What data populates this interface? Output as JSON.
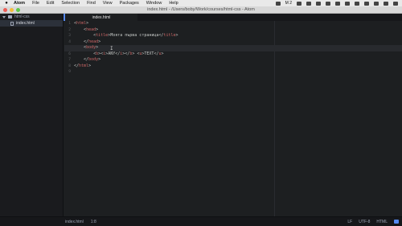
{
  "menubar": {
    "apple_icon": "apple-icon",
    "items": [
      "Atom",
      "File",
      "Edit",
      "Selection",
      "Find",
      "View",
      "Packages",
      "Window",
      "Help"
    ],
    "status_text": "M 2"
  },
  "window": {
    "title": "index.html - /Users/boby/Work/courses/html-css - Atom"
  },
  "tabs": [
    {
      "label": "index.html",
      "active": true
    }
  ],
  "tree": {
    "project": "html-css",
    "files": [
      "index.html"
    ]
  },
  "editor": {
    "line_numbers": [
      "1",
      "2",
      "3",
      "4",
      "5",
      "6",
      "7",
      "8",
      "9"
    ],
    "active_line": 5
  },
  "code": {
    "l1": {
      "open": "<",
      "tag": "html",
      "close": ">"
    },
    "l2": {
      "open": "<",
      "tag": "head",
      "close": ">"
    },
    "l3": {
      "open": "<",
      "tag": "title",
      "close": ">",
      "text": "Моята първа страница",
      "eopen": "</",
      "etag": "title",
      "eclose": ">"
    },
    "l4": {
      "open": "</",
      "tag": "head",
      "close": ">"
    },
    "l5": {
      "open": "<",
      "tag": "body",
      "close": ">"
    },
    "l6": {
      "b_open": "<",
      "b_tag": "b",
      "b_close": ">",
      "i_open": "<",
      "i_tag": "i",
      "i_close": ">",
      "text1": "ANY",
      "i_eopen": "</",
      "i_etag": "i",
      "i_eclose": ">",
      "b_eopen": "</",
      "b_etag": "b",
      "b_eclose": ">",
      "space": " ",
      "u_open": "<",
      "u_tag": "u",
      "u_close": ">",
      "text2": "TEXT",
      "u_eopen": "</",
      "u_etag": "u",
      "u_eclose": ">"
    },
    "l7": {
      "open": "</",
      "tag": "body",
      "close": ">"
    },
    "l8": {
      "open": "</",
      "tag": "html",
      "close": ">"
    }
  },
  "statusbar": {
    "file": "index.html",
    "cursor": "1:8",
    "line_ending": "LF",
    "encoding": "UTF-8",
    "grammar": "HTML"
  },
  "colors": {
    "tag": "#cc6666",
    "background": "#1d1f21",
    "accent": "#568af2"
  }
}
